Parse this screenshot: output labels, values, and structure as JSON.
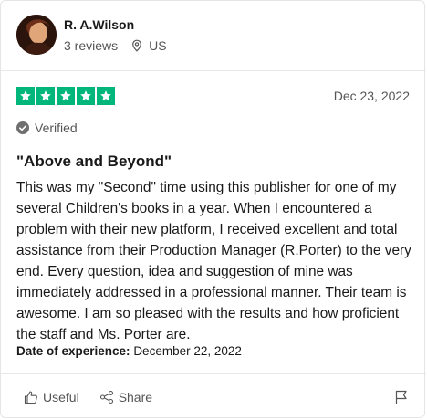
{
  "reviewer": {
    "name": "R. A.Wilson",
    "reviews_count": "3 reviews",
    "country": "US"
  },
  "review": {
    "rating": 5,
    "date": "Dec 23, 2022",
    "verified_label": "Verified",
    "title": "\"Above and Beyond\"",
    "body": "This was my \"Second\" time using this publisher for one of my several Children's books in a year. When I encountered a problem with their new platform, I received excellent and total assistance from their Production Manager (R.Porter) to the very end. Every question, idea and suggestion of mine was immediately addressed in a professional manner. Their team is awesome. I am so pleased with the results and how proficient the staff and Ms. Porter are.",
    "experience_label": "Date of experience:",
    "experience_date": "December 22, 2022"
  },
  "actions": {
    "useful_label": "Useful",
    "share_label": "Share"
  },
  "colors": {
    "star_green": "#00b67a",
    "muted_text": "#555555"
  },
  "icons": {
    "location": "location-pin-icon",
    "verified": "check-circle-icon",
    "useful": "thumbs-up-icon",
    "share": "share-icon",
    "report": "flag-icon"
  }
}
